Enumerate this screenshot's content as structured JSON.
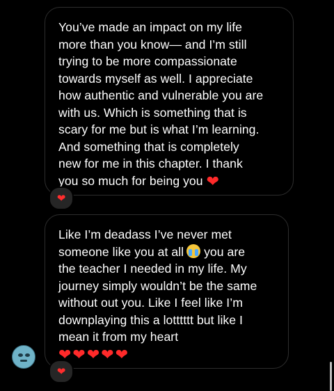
{
  "messages": [
    {
      "lines": [
        "You’ve made an impact on my life",
        "more than you know— and I’m still",
        "trying to be more compassionate",
        "towards myself as well. I appreciate",
        "how authentic and vulnerable you are",
        "with us. Which is something that is",
        "scary for me but is what I’m learning.",
        "And something that is completely",
        "new for me in this chapter. I thank",
        "you so much for being you"
      ],
      "end_emoji": "❤",
      "reaction": "❤"
    },
    {
      "lines": [
        "Like I’m deadass I’ve never met",
        "someone like you at all",
        "you are",
        "the teacher I needed in my life. My",
        "journey simply wouldn’t be the same",
        "without out you. Like I feel like I’m",
        "downplaying this a lotttttt but like I",
        "mean it from my heart"
      ],
      "hearts": "❤❤❤❤❤",
      "reaction": "❤"
    }
  ],
  "icons": {
    "reaction": "red-heart-icon",
    "inline": "loudly-crying-face-icon",
    "avatar": "sender-avatar"
  },
  "colors": {
    "background": "#000000",
    "bubble_border": "#2e2e2e",
    "text": "#ffffff",
    "heart": "#ff2a2a",
    "reaction_pill": "#262626"
  }
}
